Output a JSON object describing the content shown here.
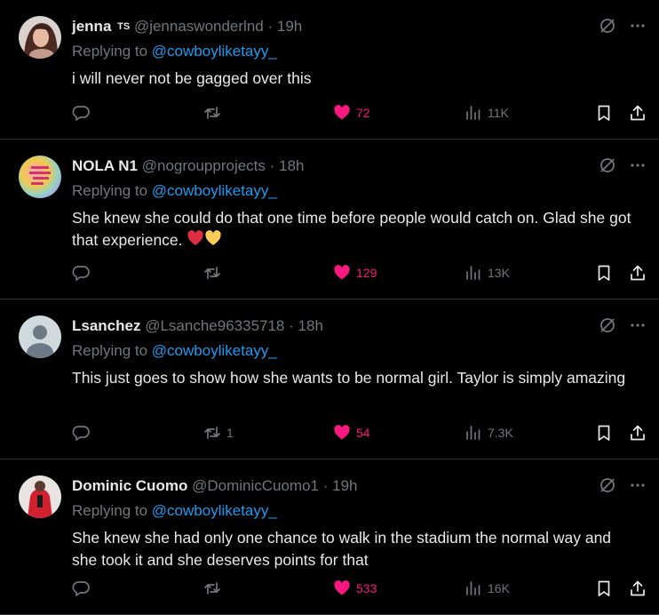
{
  "tweets": [
    {
      "name": "jenna",
      "badge": "TS",
      "handle": "@jennaswonderlnd",
      "time": "19h",
      "replying_label": "Replying to",
      "reply_to": "@cowboyliketayy_",
      "text": "i will never not be gagged over this",
      "replies": "",
      "retweets": "",
      "likes": "72",
      "views": "11K"
    },
    {
      "name": "NOLA N1",
      "handle": "@nogroupprojects",
      "time": "18h",
      "replying_label": "Replying to",
      "reply_to": "@cowboyliketayy_",
      "text": "She knew she could do that one time before people would catch on. Glad she got that experience.",
      "replies": "",
      "retweets": "",
      "likes": "129",
      "views": "13K"
    },
    {
      "name": "Lsanchez",
      "handle": "@Lsanche96335718",
      "time": "18h",
      "replying_label": "Replying to",
      "reply_to": "@cowboyliketayy_",
      "text": "This just goes to show how she wants to be normal girl. Taylor is simply amazing",
      "replies": "",
      "retweets": "1",
      "likes": "54",
      "views": "7.3K"
    },
    {
      "name": "Dominic Cuomo",
      "handle": "@DominicCuomo1",
      "time": "19h",
      "replying_label": "Replying to",
      "reply_to": "@cowboyliketayy_",
      "text": "She knew she had only one chance to walk in the stadium the normal way and she took it and she deserves points for that",
      "replies": "",
      "retweets": "",
      "likes": "533",
      "views": "16K"
    }
  ],
  "separator": "·",
  "icons": {
    "reply": "reply-icon",
    "retweet": "retweet-icon",
    "like": "heart-filled-icon",
    "views": "analytics-icon",
    "bookmark": "bookmark-icon",
    "share": "share-icon",
    "grok": "grok-icon",
    "more": "more-icon"
  },
  "colors": {
    "background": "#000000",
    "text": "#e7e9ea",
    "muted": "#71767b",
    "link": "#1d9bf0",
    "like": "#f91880",
    "divider": "#2f3336"
  }
}
